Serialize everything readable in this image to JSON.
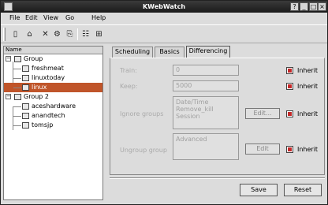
{
  "window": {
    "title": "KWebWatch",
    "controls": [
      "?",
      "_",
      "□",
      "×"
    ]
  },
  "menu": [
    "File",
    "Edit",
    "View",
    "Go",
    "Help"
  ],
  "toolbar": {
    "icons": [
      "new-icon",
      "open-icon",
      "delete-icon",
      "settings-icon",
      "copy-icon",
      "list-view-icon",
      "detail-view-icon"
    ],
    "glyphs": [
      "▯",
      "⌂",
      "✕",
      "⚙",
      "⎘",
      "☷",
      "⊞"
    ]
  },
  "tree": {
    "header": "Name",
    "items": [
      {
        "label": "Group",
        "level": 0,
        "expanded": true
      },
      {
        "label": "freshmeat",
        "level": 1
      },
      {
        "label": "linuxtoday",
        "level": 1
      },
      {
        "label": "linux",
        "level": 1,
        "selected": true
      },
      {
        "label": "Group 2",
        "level": 0,
        "expanded": true
      },
      {
        "label": "aceshardware",
        "level": 1
      },
      {
        "label": "anandtech",
        "level": 1
      },
      {
        "label": "tomsjp",
        "level": 1
      }
    ]
  },
  "tabs": [
    {
      "label": "Scheduling",
      "active": false
    },
    {
      "label": "Basics",
      "active": false
    },
    {
      "label": "Differencing",
      "active": true
    }
  ],
  "form": {
    "train_label": "Train:",
    "train_value": "0",
    "keep_label": "Keep:",
    "keep_value": "5000",
    "ignore_label": "Ignore groups",
    "ignore_items": [
      "Date/Time",
      "Remove_kill",
      "Session"
    ],
    "ignore_button": "Edit...",
    "ignore2_label": "Ungroup group",
    "ignore2_items": [
      "Advanced"
    ],
    "ignore2_button": "Edit",
    "inherit_label": "Inherit"
  },
  "buttons": {
    "save": "Save",
    "reset": "Reset"
  }
}
